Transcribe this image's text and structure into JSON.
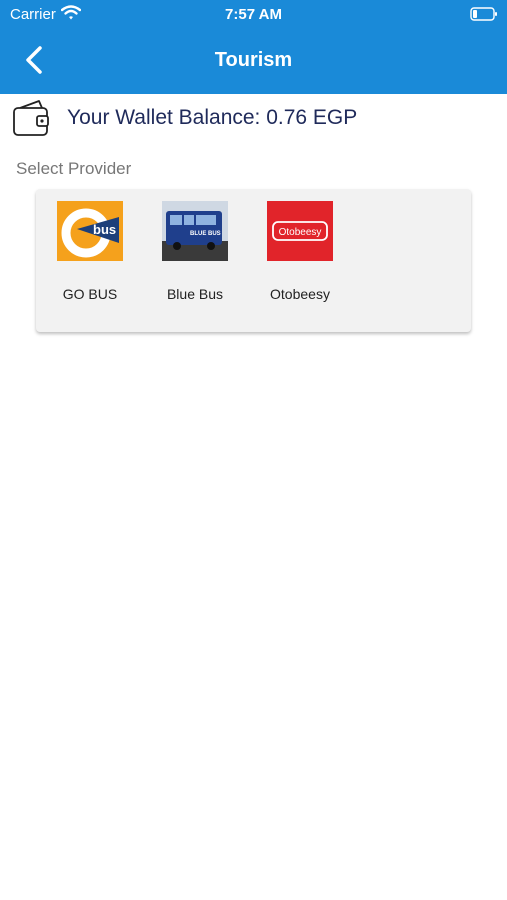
{
  "status_bar": {
    "carrier": "Carrier",
    "time": "7:57 AM"
  },
  "header": {
    "title": "Tourism"
  },
  "wallet": {
    "balance_text": "Your Wallet Balance: 0.76 EGP"
  },
  "providers_section": {
    "label": "Select Provider",
    "providers": [
      {
        "name": "GO BUS",
        "logo": "gobus-logo",
        "logo_text": "bus"
      },
      {
        "name": "Blue Bus",
        "logo": "bluebus-photo",
        "logo_text": "BLUE BUS"
      },
      {
        "name": "Otobeesy",
        "logo": "otobeesy-logo",
        "logo_text": "Otobeesy"
      }
    ]
  },
  "colors": {
    "header": "#1a8ad8",
    "gobus": "#f5a11c",
    "otobeesy": "#e1242a"
  }
}
